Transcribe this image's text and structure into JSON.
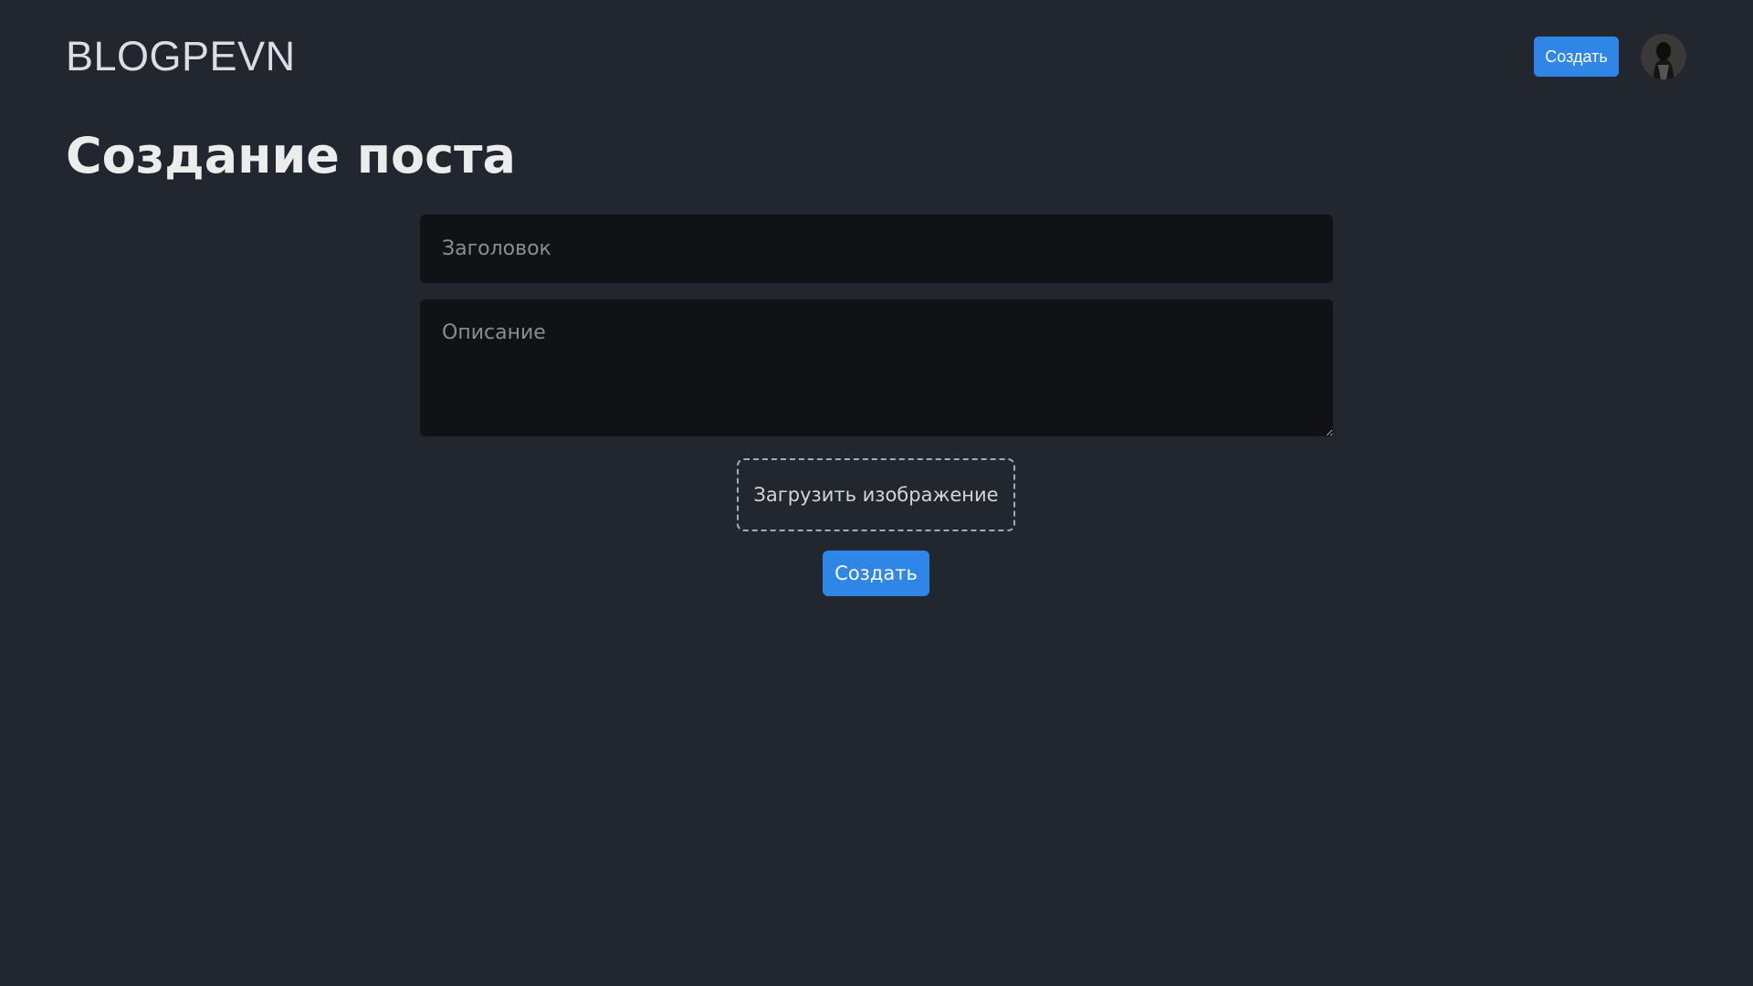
{
  "header": {
    "logo": "BLOGPEVN",
    "create_label": "Создать"
  },
  "page": {
    "title": "Создание поста"
  },
  "form": {
    "title_placeholder": "Заголовок",
    "title_value": "",
    "description_placeholder": "Описание",
    "description_value": "",
    "upload_label": "Загрузить изображение",
    "submit_label": "Создать"
  },
  "colors": {
    "background": "#22262f",
    "input_background": "#111216",
    "accent": "#2f86e6"
  },
  "icons": {
    "avatar": "user-avatar-icon"
  }
}
